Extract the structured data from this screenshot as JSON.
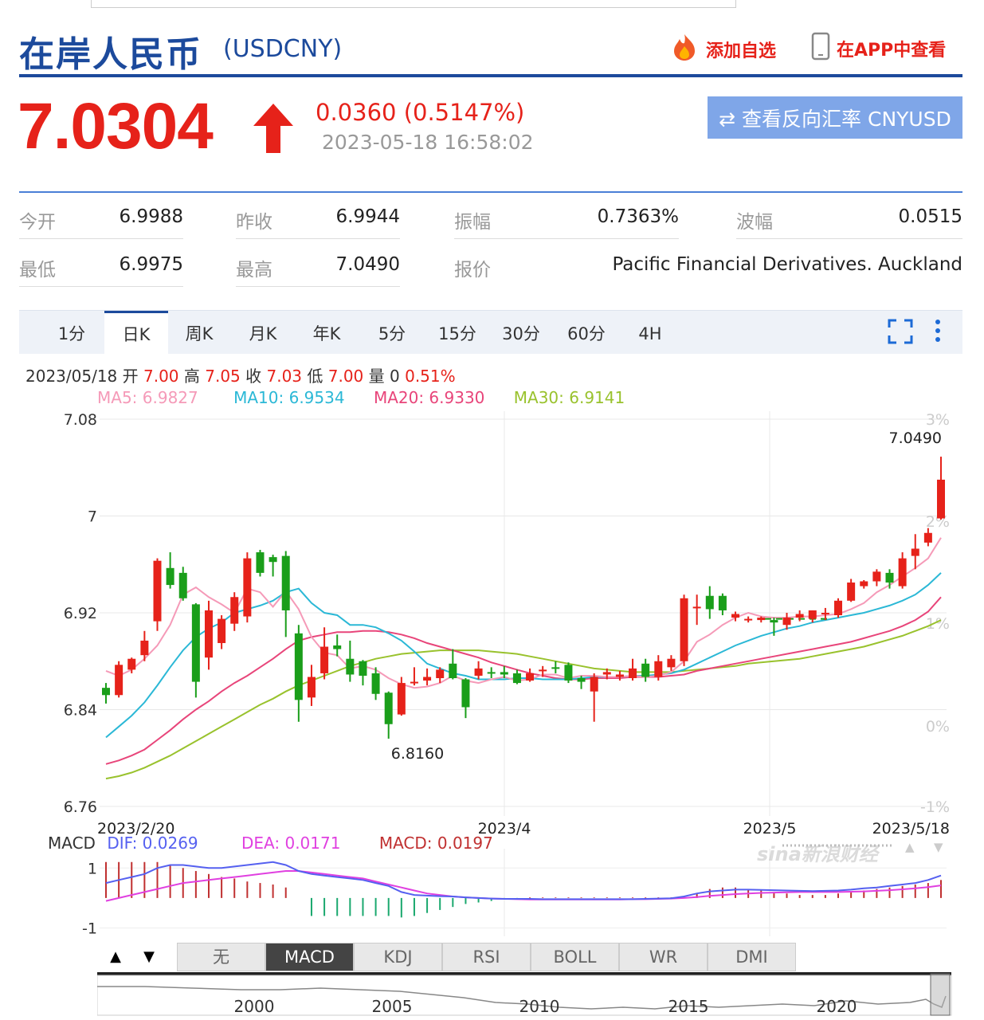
{
  "header": {
    "title": "在岸人民币",
    "symbol": "(USDCNY)",
    "add_fav": "添加自选",
    "app_view": "在APP中查看"
  },
  "quote": {
    "price": "7.0304",
    "change": "0.0360 (0.5147%)",
    "time": "2023-05-18 16:58:02",
    "reverse_button": "⇄ 查看反向汇率 CNYUSD"
  },
  "stats": {
    "open_label": "今开",
    "open": "6.9988",
    "prev_label": "昨收",
    "prev": "6.9944",
    "amp_label": "振幅",
    "amp": "0.7363%",
    "wave_label": "波幅",
    "wave": "0.0515",
    "low_label": "最低",
    "low": "6.9975",
    "high_label": "最高",
    "high": "7.0490",
    "quote_label": "报价",
    "quote_src": "Pacific Financial Derivatives. Auckland"
  },
  "tabs": [
    "1分",
    "日K",
    "周K",
    "月K",
    "年K",
    "5分",
    "15分",
    "30分",
    "60分",
    "4H"
  ],
  "active_tab": "日K",
  "info": {
    "date": "2023/05/18",
    "open_label": "开",
    "open": "7.00",
    "high_label": "高",
    "high": "7.05",
    "close_label": "收",
    "close": "7.03",
    "low_label": "低",
    "low": "7.00",
    "vol_label": "量",
    "vol": "0",
    "pct": "0.51%"
  },
  "ma": {
    "ma5": "MA5: 6.9827",
    "ma10": "MA10: 6.9534",
    "ma20": "MA20: 6.9330",
    "ma30": "MA30: 6.9141"
  },
  "colors": {
    "up": "#e6221a",
    "down": "#1a9e1a",
    "ma5": "#f59ab8",
    "ma10": "#2bb8d6",
    "ma20": "#e8457a",
    "ma30": "#99c22d",
    "dif": "#5560f0",
    "dea": "#e040e0",
    "macd": "#c03030"
  },
  "watermark": "sina新浪财经",
  "chart_data": {
    "type": "candlestick",
    "ylim": [
      6.76,
      7.08
    ],
    "yticks": [
      "7.08",
      "7",
      "6.92",
      "6.84",
      "6.76"
    ],
    "pct_ticks": [
      "3%",
      "2%",
      "1%",
      "0%",
      "-1%"
    ],
    "xticks": [
      "2023/2/20",
      "2023/4",
      "2023/5",
      "2023/5/18"
    ],
    "max_label": "7.0490",
    "min_label": "6.8160",
    "candles": [
      {
        "o": 6.858,
        "h": 6.862,
        "l": 6.845,
        "c": 6.852
      },
      {
        "o": 6.852,
        "h": 6.88,
        "l": 6.85,
        "c": 6.877
      },
      {
        "o": 6.873,
        "h": 6.883,
        "l": 6.87,
        "c": 6.882
      },
      {
        "o": 6.885,
        "h": 6.905,
        "l": 6.88,
        "c": 6.897
      },
      {
        "o": 6.913,
        "h": 6.965,
        "l": 6.905,
        "c": 6.963
      },
      {
        "o": 6.957,
        "h": 6.97,
        "l": 6.94,
        "c": 6.943
      },
      {
        "o": 6.953,
        "h": 6.958,
        "l": 6.93,
        "c": 6.932
      },
      {
        "o": 6.927,
        "h": 6.928,
        "l": 6.85,
        "c": 6.863
      },
      {
        "o": 6.883,
        "h": 6.93,
        "l": 6.873,
        "c": 6.922
      },
      {
        "o": 6.895,
        "h": 6.918,
        "l": 6.89,
        "c": 6.915
      },
      {
        "o": 6.911,
        "h": 6.937,
        "l": 6.905,
        "c": 6.933
      },
      {
        "o": 6.917,
        "h": 6.97,
        "l": 6.912,
        "c": 6.965
      },
      {
        "o": 6.97,
        "h": 6.972,
        "l": 6.95,
        "c": 6.953
      },
      {
        "o": 6.966,
        "h": 6.968,
        "l": 6.95,
        "c": 6.962
      },
      {
        "o": 6.967,
        "h": 6.971,
        "l": 6.9,
        "c": 6.922
      },
      {
        "o": 6.903,
        "h": 6.91,
        "l": 6.83,
        "c": 6.848
      },
      {
        "o": 6.85,
        "h": 6.877,
        "l": 6.843,
        "c": 6.867
      },
      {
        "o": 6.87,
        "h": 6.908,
        "l": 6.865,
        "c": 6.892
      },
      {
        "o": 6.893,
        "h": 6.902,
        "l": 6.884,
        "c": 6.89
      },
      {
        "o": 6.882,
        "h": 6.897,
        "l": 6.863,
        "c": 6.869
      },
      {
        "o": 6.88,
        "h": 6.881,
        "l": 6.86,
        "c": 6.868
      },
      {
        "o": 6.87,
        "h": 6.875,
        "l": 6.848,
        "c": 6.853
      },
      {
        "o": 6.854,
        "h": 6.855,
        "l": 6.816,
        "c": 6.828
      },
      {
        "o": 6.836,
        "h": 6.867,
        "l": 6.835,
        "c": 6.862
      },
      {
        "o": 6.862,
        "h": 6.875,
        "l": 6.86,
        "c": 6.863
      },
      {
        "o": 6.864,
        "h": 6.874,
        "l": 6.86,
        "c": 6.867
      },
      {
        "o": 6.866,
        "h": 6.875,
        "l": 6.862,
        "c": 6.873
      },
      {
        "o": 6.878,
        "h": 6.89,
        "l": 6.865,
        "c": 6.866
      },
      {
        "o": 6.865,
        "h": 6.866,
        "l": 6.833,
        "c": 6.842
      },
      {
        "o": 6.868,
        "h": 6.88,
        "l": 6.865,
        "c": 6.874
      },
      {
        "o": 6.871,
        "h": 6.875,
        "l": 6.866,
        "c": 6.87
      },
      {
        "o": 6.871,
        "h": 6.876,
        "l": 6.866,
        "c": 6.869
      },
      {
        "o": 6.87,
        "h": 6.873,
        "l": 6.861,
        "c": 6.862
      },
      {
        "o": 6.864,
        "h": 6.874,
        "l": 6.863,
        "c": 6.87
      },
      {
        "o": 6.872,
        "h": 6.876,
        "l": 6.867,
        "c": 6.873
      },
      {
        "o": 6.875,
        "h": 6.88,
        "l": 6.87,
        "c": 6.874
      },
      {
        "o": 6.877,
        "h": 6.879,
        "l": 6.862,
        "c": 6.864
      },
      {
        "o": 6.866,
        "h": 6.868,
        "l": 6.857,
        "c": 6.863
      },
      {
        "o": 6.855,
        "h": 6.87,
        "l": 6.83,
        "c": 6.867
      },
      {
        "o": 6.869,
        "h": 6.874,
        "l": 6.865,
        "c": 6.871
      },
      {
        "o": 6.867,
        "h": 6.872,
        "l": 6.864,
        "c": 6.869
      },
      {
        "o": 6.866,
        "h": 6.882,
        "l": 6.864,
        "c": 6.874
      },
      {
        "o": 6.878,
        "h": 6.882,
        "l": 6.863,
        "c": 6.867
      },
      {
        "o": 6.867,
        "h": 6.885,
        "l": 6.864,
        "c": 6.88
      },
      {
        "o": 6.875,
        "h": 6.885,
        "l": 6.872,
        "c": 6.882
      },
      {
        "o": 6.88,
        "h": 6.935,
        "l": 6.876,
        "c": 6.932
      },
      {
        "o": 6.925,
        "h": 6.935,
        "l": 6.91,
        "c": 6.925
      },
      {
        "o": 6.934,
        "h": 6.942,
        "l": 6.915,
        "c": 6.923
      },
      {
        "o": 6.934,
        "h": 6.936,
        "l": 6.918,
        "c": 6.922
      },
      {
        "o": 6.916,
        "h": 6.921,
        "l": 6.913,
        "c": 6.919
      },
      {
        "o": 6.915,
        "h": 6.917,
        "l": 6.912,
        "c": 6.915
      },
      {
        "o": 6.914,
        "h": 6.917,
        "l": 6.912,
        "c": 6.916
      },
      {
        "o": 6.914,
        "h": 6.916,
        "l": 6.901,
        "c": 6.912
      },
      {
        "o": 6.91,
        "h": 6.92,
        "l": 6.906,
        "c": 6.916
      },
      {
        "o": 6.916,
        "h": 6.922,
        "l": 6.913,
        "c": 6.919
      },
      {
        "o": 6.915,
        "h": 6.922,
        "l": 6.912,
        "c": 6.922
      },
      {
        "o": 6.92,
        "h": 6.924,
        "l": 6.914,
        "c": 6.92
      },
      {
        "o": 6.918,
        "h": 6.932,
        "l": 6.916,
        "c": 6.93
      },
      {
        "o": 6.93,
        "h": 6.948,
        "l": 6.929,
        "c": 6.945
      },
      {
        "o": 6.942,
        "h": 6.947,
        "l": 6.94,
        "c": 6.946
      },
      {
        "o": 6.946,
        "h": 6.956,
        "l": 6.942,
        "c": 6.954
      },
      {
        "o": 6.953,
        "h": 6.956,
        "l": 6.94,
        "c": 6.945
      },
      {
        "o": 6.942,
        "h": 6.97,
        "l": 6.94,
        "c": 6.965
      },
      {
        "o": 6.967,
        "h": 6.985,
        "l": 6.956,
        "c": 6.973
      },
      {
        "o": 6.978,
        "h": 6.99,
        "l": 6.975,
        "c": 6.986
      },
      {
        "o": 6.998,
        "h": 7.049,
        "l": 6.997,
        "c": 7.03
      }
    ],
    "ma5": [
      6.872,
      6.868,
      6.873,
      6.882,
      6.893,
      6.91,
      6.935,
      6.941,
      6.933,
      6.927,
      6.92,
      6.94,
      6.937,
      6.925,
      6.938,
      6.923,
      6.9,
      6.887,
      6.885,
      6.874,
      6.876,
      6.873,
      6.866,
      6.861,
      6.858,
      6.859,
      6.862,
      6.868,
      6.864,
      6.862,
      6.865,
      6.867,
      6.864,
      6.865,
      6.869,
      6.869,
      6.866,
      6.868,
      6.868,
      6.867,
      6.867,
      6.868,
      6.867,
      6.868,
      6.871,
      6.88,
      6.896,
      6.902,
      6.91,
      6.916,
      6.92,
      6.917,
      6.916,
      6.916,
      6.917,
      6.917,
      6.918,
      6.919,
      6.923,
      6.928,
      6.937,
      6.943,
      6.95,
      6.957,
      6.965,
      6.982
    ],
    "ma10": [
      6.817,
      6.826,
      6.835,
      6.846,
      6.86,
      6.875,
      6.889,
      6.9,
      6.907,
      6.912,
      6.92,
      6.923,
      6.926,
      6.93,
      6.937,
      6.94,
      6.928,
      6.92,
      6.918,
      6.91,
      6.91,
      6.908,
      6.903,
      6.897,
      6.888,
      6.878,
      6.874,
      6.87,
      6.868,
      6.865,
      6.865,
      6.865,
      6.866,
      6.866,
      6.865,
      6.865,
      6.865,
      6.866,
      6.867,
      6.867,
      6.867,
      6.868,
      6.868,
      6.869,
      6.87,
      6.873,
      6.878,
      6.883,
      6.888,
      6.893,
      6.897,
      6.901,
      6.904,
      6.907,
      6.909,
      6.912,
      6.914,
      6.916,
      6.918,
      6.92,
      6.923,
      6.926,
      6.93,
      6.935,
      6.943,
      6.953
    ],
    "ma20": [
      6.795,
      6.798,
      6.802,
      6.807,
      6.815,
      6.823,
      6.832,
      6.84,
      6.847,
      6.855,
      6.862,
      6.868,
      6.875,
      6.882,
      6.89,
      6.897,
      6.9,
      6.902,
      6.904,
      6.904,
      6.905,
      6.905,
      6.904,
      6.902,
      6.899,
      6.895,
      6.892,
      6.889,
      6.886,
      6.883,
      6.879,
      6.876,
      6.873,
      6.87,
      6.868,
      6.866,
      6.865,
      6.865,
      6.866,
      6.866,
      6.866,
      6.867,
      6.867,
      6.867,
      6.868,
      6.869,
      6.872,
      6.874,
      6.876,
      6.878,
      6.88,
      6.882,
      6.884,
      6.886,
      6.888,
      6.89,
      6.892,
      6.894,
      6.896,
      6.899,
      6.902,
      6.905,
      6.909,
      6.914,
      6.921,
      6.933
    ],
    "ma30": [
      6.783,
      6.785,
      6.788,
      6.792,
      6.797,
      6.802,
      6.808,
      6.814,
      6.82,
      6.826,
      6.832,
      6.838,
      6.844,
      6.849,
      6.855,
      6.86,
      6.864,
      6.868,
      6.872,
      6.876,
      6.879,
      6.882,
      6.884,
      6.886,
      6.887,
      6.888,
      6.889,
      6.889,
      6.889,
      6.889,
      6.888,
      6.887,
      6.886,
      6.884,
      6.882,
      6.88,
      6.878,
      6.876,
      6.874,
      6.873,
      6.872,
      6.871,
      6.871,
      6.871,
      6.871,
      6.872,
      6.873,
      6.874,
      6.875,
      6.876,
      6.878,
      6.879,
      6.88,
      6.881,
      6.882,
      6.884,
      6.886,
      6.888,
      6.89,
      6.892,
      6.895,
      6.898,
      6.901,
      6.905,
      6.909,
      6.914
    ]
  },
  "macd": {
    "title": "MACD",
    "dif_label": "DIF: 0.0269",
    "dea_label": "DEA: 0.0171",
    "macd_label": "MACD: 0.0197",
    "yticks": [
      "1",
      "-1"
    ],
    "ylim": [
      -1.2,
      1.3
    ],
    "dif": [
      0.5,
      0.6,
      0.7,
      0.8,
      1.0,
      1.1,
      1.1,
      1.05,
      1.0,
      1.0,
      1.05,
      1.1,
      1.15,
      1.2,
      1.1,
      0.9,
      0.8,
      0.75,
      0.7,
      0.65,
      0.6,
      0.5,
      0.4,
      0.2,
      0.1,
      0.08,
      0.06,
      0.05,
      0.02,
      0.0,
      -0.02,
      -0.03,
      -0.03,
      -0.03,
      -0.04,
      -0.04,
      -0.04,
      -0.04,
      -0.04,
      -0.04,
      -0.04,
      -0.04,
      -0.03,
      -0.02,
      -0.01,
      0.05,
      0.15,
      0.22,
      0.25,
      0.28,
      0.28,
      0.27,
      0.26,
      0.25,
      0.24,
      0.23,
      0.24,
      0.25,
      0.28,
      0.32,
      0.35,
      0.4,
      0.45,
      0.5,
      0.6,
      0.75
    ],
    "dea": [
      -0.1,
      0.0,
      0.1,
      0.2,
      0.3,
      0.4,
      0.5,
      0.55,
      0.6,
      0.65,
      0.7,
      0.75,
      0.8,
      0.85,
      0.9,
      0.9,
      0.85,
      0.8,
      0.75,
      0.7,
      0.65,
      0.55,
      0.45,
      0.35,
      0.25,
      0.15,
      0.1,
      0.05,
      0.02,
      0.0,
      -0.02,
      -0.03,
      -0.04,
      -0.05,
      -0.05,
      -0.05,
      -0.05,
      -0.05,
      -0.05,
      -0.05,
      -0.05,
      -0.04,
      -0.04,
      -0.03,
      -0.02,
      0.0,
      0.03,
      0.07,
      0.1,
      0.13,
      0.15,
      0.17,
      0.18,
      0.19,
      0.2,
      0.2,
      0.2,
      0.2,
      0.21,
      0.22,
      0.24,
      0.26,
      0.29,
      0.32,
      0.36,
      0.42
    ],
    "bars": [
      1.2,
      1.2,
      1.2,
      1.2,
      1.2,
      1.1,
      1.0,
      0.9,
      0.8,
      0.7,
      0.65,
      0.55,
      0.5,
      0.45,
      0.35,
      0.0,
      -0.6,
      -0.6,
      -0.6,
      -0.6,
      -0.6,
      -0.6,
      -0.6,
      -0.65,
      -0.6,
      -0.5,
      -0.4,
      -0.3,
      -0.2,
      -0.15,
      -0.1,
      -0.05,
      -0.03,
      0.02,
      0.02,
      0.02,
      0.02,
      0.02,
      0.02,
      0.02,
      0.02,
      0.02,
      0.02,
      0.02,
      0.02,
      0.05,
      0.15,
      0.3,
      0.35,
      0.35,
      0.3,
      0.25,
      0.2,
      0.15,
      0.1,
      0.1,
      0.1,
      0.15,
      0.2,
      0.25,
      0.3,
      0.35,
      0.4,
      0.45,
      0.5,
      0.6
    ]
  },
  "indicators": [
    "无",
    "MACD",
    "KDJ",
    "RSI",
    "BOLL",
    "WR",
    "DMI"
  ],
  "active_indicator": "MACD",
  "nav_years": [
    "2000",
    "2005",
    "2010",
    "2015",
    "2020"
  ]
}
